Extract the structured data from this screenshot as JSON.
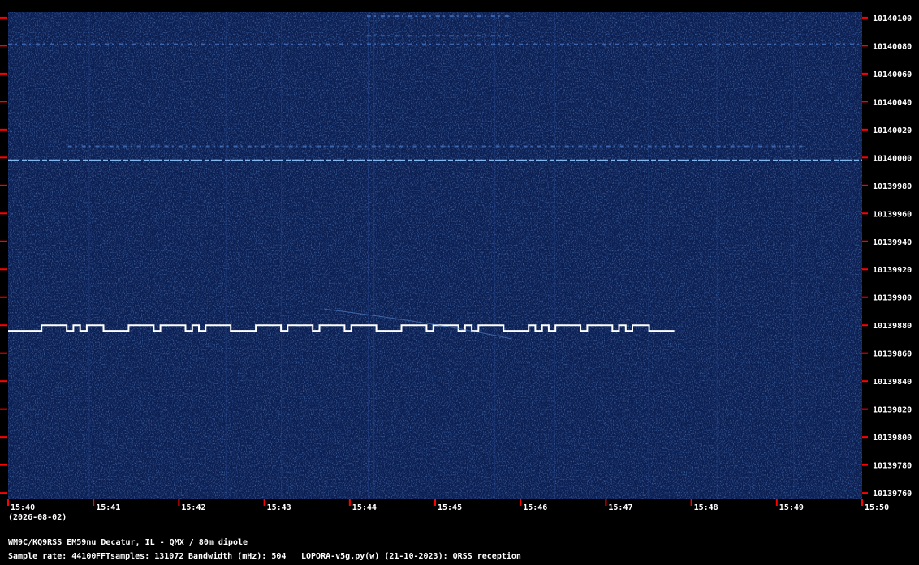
{
  "chart_data": {
    "type": "spectrogram",
    "x": {
      "tick_labels": [
        "15:40",
        "15:41",
        "15:42",
        "15:43",
        "15:44",
        "15:45",
        "15:46",
        "15:47",
        "15:48",
        "15:49",
        "15:50"
      ],
      "date_label": "(2026-08-02)",
      "range_min": [
        0,
        10
      ]
    },
    "y": {
      "tick_labels": [
        "10140100",
        "10140080",
        "10140060",
        "10140040",
        "10140020",
        "10140000",
        "10139980",
        "10139960",
        "10139940",
        "10139920",
        "10139900",
        "10139880",
        "10139860",
        "10139840",
        "10139820",
        "10139800",
        "10139780",
        "10139760"
      ],
      "range_hz": [
        10139756,
        10140104
      ]
    },
    "signals": [
      {
        "freq_hz": 10140008,
        "t_start_min": 0.7,
        "t_end_min": 9.3,
        "intensity": "faint"
      },
      {
        "freq_hz": 10139998,
        "t_start_min": 0,
        "t_end_min": 10,
        "intensity": "carrier"
      },
      {
        "freq_hz": 10140081,
        "t_start_min": 0,
        "t_end_min": 10,
        "intensity": "faint"
      },
      {
        "freq_hz": 10140087,
        "t_start_min": 4.2,
        "t_end_min": 5.9,
        "intensity": "faint"
      },
      {
        "freq_hz": 10140101,
        "t_start_min": 4.2,
        "t_end_min": 5.9,
        "intensity": "faint"
      }
    ],
    "fsk_trace": {
      "base_freq_hz": 10139876,
      "high_freq_hz": 10139880,
      "t_start_min": 0,
      "t_end_min": 7.8,
      "pattern": [
        [
          "L",
          0.4
        ],
        [
          "H",
          0.3
        ],
        [
          "L",
          0.08
        ],
        [
          "H",
          0.08
        ],
        [
          "L",
          0.08
        ],
        [
          "H",
          0.2
        ],
        [
          "L",
          0.3
        ],
        [
          "H",
          0.3
        ],
        [
          "L",
          0.08
        ],
        [
          "H",
          0.3
        ],
        [
          "L",
          0.08
        ],
        [
          "H",
          0.08
        ],
        [
          "L",
          0.08
        ],
        [
          "H",
          0.3
        ],
        [
          "L",
          0.3
        ],
        [
          "H",
          0.3
        ],
        [
          "L",
          0.08
        ],
        [
          "H",
          0.3
        ],
        [
          "L",
          0.08
        ],
        [
          "H",
          0.3
        ],
        [
          "L",
          0.08
        ],
        [
          "H",
          0.3
        ],
        [
          "L",
          0.3
        ],
        [
          "H",
          0.3
        ],
        [
          "L",
          0.08
        ],
        [
          "H",
          0.3
        ],
        [
          "L",
          0.08
        ],
        [
          "H",
          0.08
        ],
        [
          "L",
          0.08
        ],
        [
          "H",
          0.3
        ],
        [
          "L",
          0.3
        ],
        [
          "H",
          0.08
        ],
        [
          "L",
          0.08
        ],
        [
          "H",
          0.08
        ],
        [
          "L",
          0.08
        ],
        [
          "H",
          0.3
        ],
        [
          "L",
          0.08
        ],
        [
          "H",
          0.3
        ],
        [
          "L",
          0.08
        ],
        [
          "H",
          0.08
        ],
        [
          "L",
          0.08
        ],
        [
          "H",
          0.2
        ],
        [
          "L",
          0.3
        ]
      ]
    },
    "colors": {
      "background": "#0c1f52",
      "noise_hi": "#1a3b80",
      "trace": "#ffffff",
      "tick": "#ff0000",
      "carrier": "#8fc7ff"
    }
  },
  "footer": {
    "station": "WM9C/KQ9RSS EM59nu Decatur, IL - QMX / 80m dipole",
    "sample_rate": "Sample rate: 44100",
    "fft_samples": "FFTsamples: 131072",
    "bandwidth": "Bandwidth (mHz): 504",
    "software": "LOPORA-v5g.py(w) (21-10-2023): QRSS reception"
  }
}
